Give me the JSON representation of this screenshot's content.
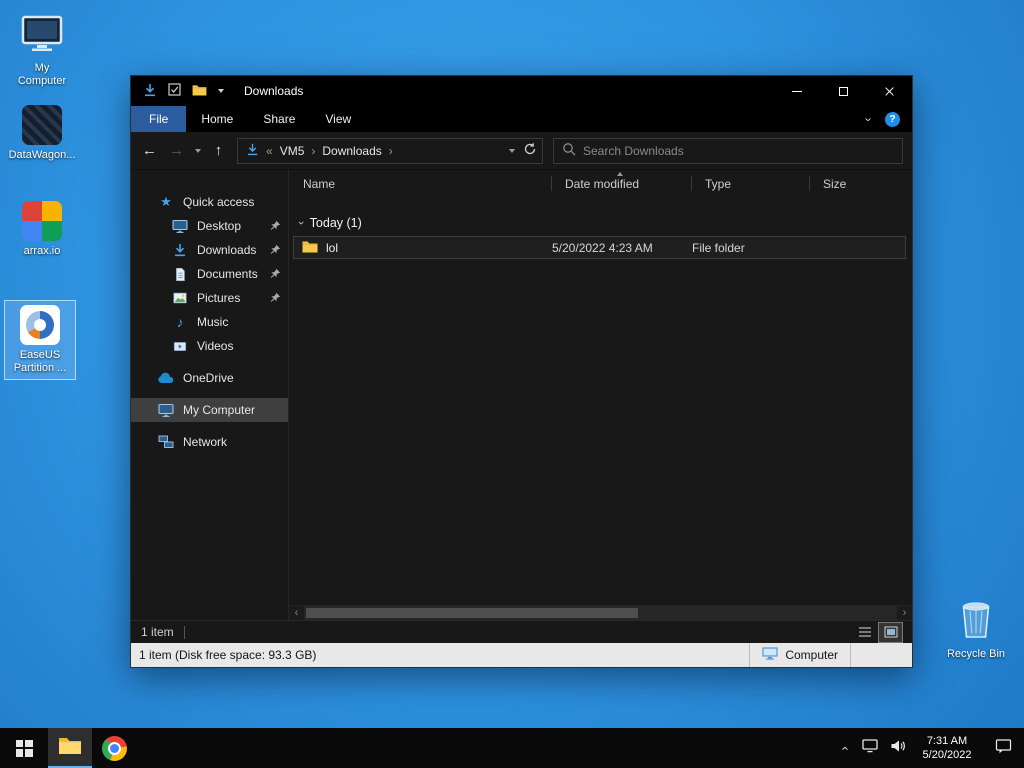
{
  "colors": {
    "desktop_blue": "#2e93e0",
    "file_tab_blue": "#2a5c9e",
    "icon_blue": "#4aa3e8",
    "window_bg": "#181818",
    "bar_black": "#000000",
    "selection_gray": "#3f3f3f",
    "status_light_bg": "#e8e8e8",
    "taskbar_bg": "#0a0a0a",
    "folder_yellow": "#f6c94a"
  },
  "icons": {
    "back": "←",
    "forward": "→",
    "up": "↑",
    "chevron": "›",
    "chevron_left": "‹",
    "overflow": "«",
    "star": "★",
    "music_note": "♪",
    "check": "✓",
    "help": "?"
  },
  "desktop": {
    "icons": [
      {
        "label": "My Computer"
      },
      {
        "label": "DataWagon..."
      },
      {
        "label": "arrax.io"
      },
      {
        "label": "EaseUS Partition ..."
      },
      {
        "label": "Recycle Bin"
      }
    ]
  },
  "explorer": {
    "titlebar": {
      "title": "Downloads"
    },
    "ribbon_tabs": [
      {
        "label": "File"
      },
      {
        "label": "Home"
      },
      {
        "label": "Share"
      },
      {
        "label": "View"
      }
    ],
    "addressbar": {
      "crumbs": [
        {
          "label": "VM5"
        },
        {
          "label": "Downloads"
        }
      ],
      "search_placeholder": "Search Downloads"
    },
    "columns": [
      {
        "label": "Name"
      },
      {
        "label": "Date modified"
      },
      {
        "label": "Type"
      },
      {
        "label": "Size"
      }
    ],
    "group": {
      "label": "Today (1)"
    },
    "files": [
      {
        "name": "lol",
        "date_modified": "5/20/2022 4:23 AM",
        "type": "File folder",
        "size": ""
      }
    ],
    "sidebar": {
      "items": [
        {
          "label": "Quick access"
        },
        {
          "label": "Desktop"
        },
        {
          "label": "Downloads"
        },
        {
          "label": "Documents"
        },
        {
          "label": "Pictures"
        },
        {
          "label": "Music"
        },
        {
          "label": "Videos"
        },
        {
          "label": "OneDrive"
        },
        {
          "label": "My Computer"
        },
        {
          "label": "Network"
        }
      ]
    },
    "status": {
      "item_count": "1 item",
      "detail_left": "1 item (Disk free space: 93.3 GB)",
      "detail_right": "Computer"
    }
  },
  "taskbar": {
    "clock": {
      "time": "7:31 AM",
      "date": "5/20/2022"
    }
  }
}
